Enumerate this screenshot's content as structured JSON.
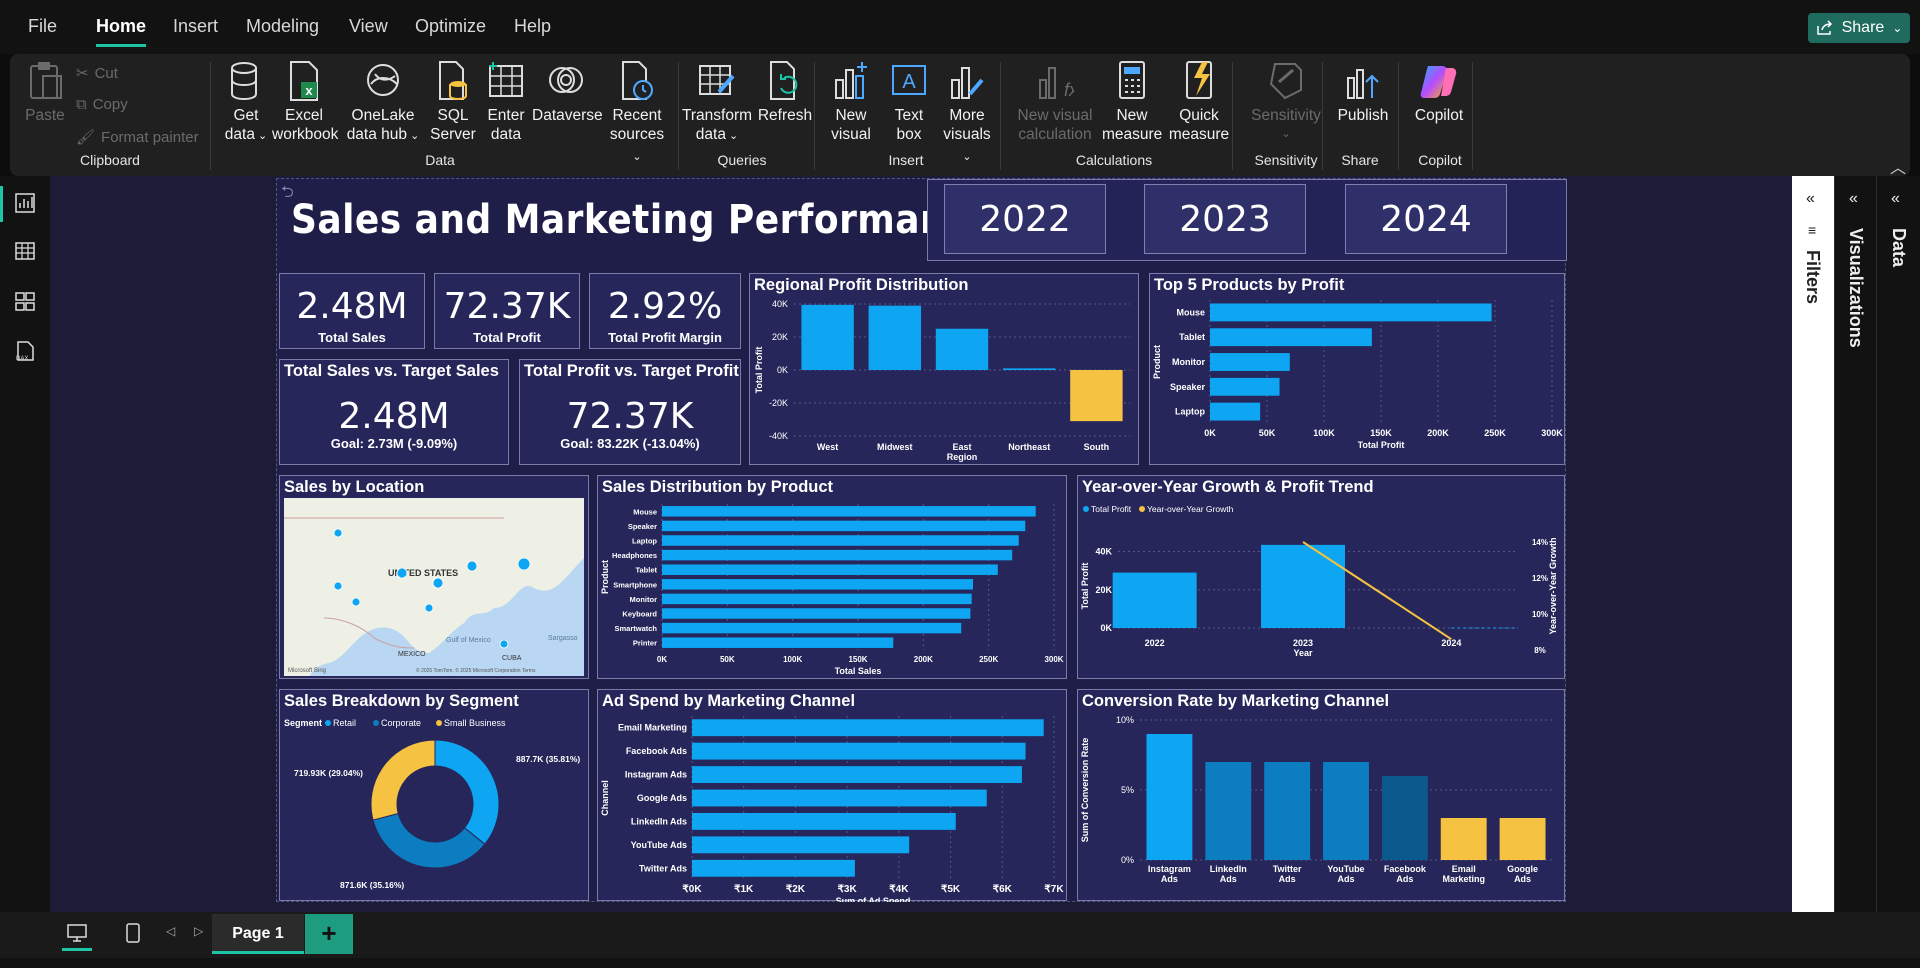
{
  "menu": {
    "items": [
      "File",
      "Home",
      "Insert",
      "Modeling",
      "View",
      "Optimize",
      "Help"
    ],
    "active": "Home",
    "share": "Share"
  },
  "ribbon": {
    "clipboard": {
      "paste": "Paste",
      "cut": "Cut",
      "copy": "Copy",
      "format_painter": "Format painter",
      "label": "Clipboard"
    },
    "data": {
      "get_data": [
        "Get",
        "data"
      ],
      "excel": [
        "Excel",
        "workbook"
      ],
      "onelake": [
        "OneLake",
        "data hub"
      ],
      "sql": [
        "SQL",
        "Server"
      ],
      "enter": [
        "Enter",
        "data"
      ],
      "dataverse": "Dataverse",
      "recent": [
        "Recent",
        "sources"
      ],
      "label": "Data"
    },
    "queries": {
      "transform": [
        "Transform",
        "data"
      ],
      "refresh": "Refresh",
      "label": "Queries"
    },
    "insert": {
      "new_visual": [
        "New",
        "visual"
      ],
      "text_box": [
        "Text",
        "box"
      ],
      "more_visuals": [
        "More",
        "visuals"
      ],
      "label": "Insert"
    },
    "calculations": {
      "new_visual_calc": [
        "New visual",
        "calculation"
      ],
      "new_measure": [
        "New",
        "measure"
      ],
      "quick_measure": [
        "Quick",
        "measure"
      ],
      "label": "Calculations"
    },
    "sensitivity": {
      "btn": "Sensitivity",
      "label": "Sensitivity"
    },
    "share": {
      "publish": "Publish",
      "label": "Share"
    },
    "copilot": {
      "btn": "Copilot",
      "label": "Copilot"
    }
  },
  "report": {
    "title": "Sales and Marketing Performance",
    "years": [
      "2022",
      "2023",
      "2024"
    ],
    "kpis": [
      {
        "value": "2.48M",
        "label": "Total Sales"
      },
      {
        "value": "72.37K",
        "label": "Total Profit"
      },
      {
        "value": "2.92%",
        "label": "Total Profit Margin"
      }
    ],
    "targets": [
      {
        "title": "Total Sales vs. Target Sales",
        "value": "2.48M",
        "goal": "Goal: 2.73M (-9.09%)"
      },
      {
        "title": "Total Profit vs. Target Profit",
        "value": "72.37K",
        "goal": "Goal: 83.22K (-13.04%)"
      }
    ],
    "map": {
      "title": "Sales by Location",
      "labels": {
        "country": "UNITED STATES",
        "mexico": "MEXICO",
        "gulf": "Gulf of Mexico",
        "cuba": "CUBA",
        "sargasso": "Sargasso",
        "brand": "Microsoft Bing",
        "copyright": "© 2025 TomTom, © 2025 Microsoft Corporation Terms"
      }
    }
  },
  "chart_data": [
    {
      "id": "regional",
      "type": "bar",
      "title": "Regional Profit Distribution",
      "categories": [
        "West",
        "Midwest",
        "East Region",
        "Northeast",
        "South"
      ],
      "values": [
        39500,
        39000,
        25000,
        1000,
        -31000
      ],
      "ylabel": "Total Profit",
      "ylim": [
        -40000,
        40000
      ],
      "yticks": [
        "40K",
        "20K",
        "0K",
        "-20K",
        "-40K"
      ],
      "colors": [
        "#0ea5f2",
        "#0ea5f2",
        "#0ea5f2",
        "#0ea5f2",
        "#f5c242"
      ]
    },
    {
      "id": "top5",
      "type": "bar",
      "orientation": "horizontal",
      "title": "Top 5 Products by Profit",
      "categories": [
        "Mouse",
        "Tablet",
        "Monitor",
        "Speaker",
        "Laptop"
      ],
      "values": [
        247000,
        142000,
        70000,
        61000,
        44000
      ],
      "xlabel": "Total Profit",
      "ylabel": "Product",
      "xlim": [
        0,
        300000
      ],
      "xticks": [
        "0K",
        "50K",
        "100K",
        "150K",
        "200K",
        "250K",
        "300K"
      ]
    },
    {
      "id": "salesprod",
      "type": "bar",
      "orientation": "horizontal",
      "title": "Sales Distribution by Product",
      "categories": [
        "Mouse",
        "Speaker",
        "Laptop",
        "Headphones",
        "Tablet",
        "Smartphone",
        "Monitor",
        "Keyboard",
        "Smartwatch",
        "Printer"
      ],
      "values": [
        286000,
        278000,
        273000,
        268000,
        257000,
        238000,
        237000,
        236000,
        229000,
        177000
      ],
      "xlabel": "Total Sales",
      "ylabel": "Product",
      "xlim": [
        0,
        300000
      ],
      "xticks": [
        "0K",
        "50K",
        "100K",
        "150K",
        "200K",
        "250K",
        "300K"
      ]
    },
    {
      "id": "yoy",
      "type": "bar",
      "title": "Year-over-Year Growth & Profit Trend",
      "categories": [
        "2022",
        "2023",
        "2024"
      ],
      "series": [
        {
          "name": "Total Profit",
          "type": "bar",
          "values": [
            29000,
            43500,
            0
          ]
        },
        {
          "name": "Year-over-Year Growth",
          "type": "line",
          "values": [
            null,
            14.0,
            8.6
          ]
        }
      ],
      "xlabel": "Year",
      "ylabel": "Total Profit",
      "y2label": "Year-over-Year Growth",
      "ylim": [
        0,
        45000
      ],
      "yticks": [
        "40K",
        "20K",
        "0K"
      ],
      "y2ticks": [
        "14%",
        "12%",
        "10%",
        "8%"
      ]
    },
    {
      "id": "segment",
      "type": "pie",
      "title": "Sales Breakdown by Segment",
      "legend_title": "Segment",
      "categories": [
        "Retail",
        "Corporate",
        "Small Business"
      ],
      "values": [
        887700,
        871600,
        719930
      ],
      "labels": [
        "887.7K (35.81%)",
        "871.6K (35.16%)",
        "719.93K (29.04%)"
      ],
      "colors": [
        "#0ea5f2",
        "#0b7dc0",
        "#f5c242"
      ]
    },
    {
      "id": "adspend",
      "type": "bar",
      "orientation": "horizontal",
      "title": "Ad Spend by Marketing Channel",
      "categories": [
        "Email Marketing",
        "Facebook Ads",
        "Instagram Ads",
        "Google Ads",
        "LinkedIn Ads",
        "YouTube Ads",
        "Twitter Ads"
      ],
      "values": [
        6800,
        6450,
        6380,
        5700,
        5100,
        4200,
        3150
      ],
      "xlabel": "Sum of Ad Spend",
      "ylabel": "Channel",
      "xlim": [
        0,
        7000
      ],
      "xticks": [
        "₹0K",
        "₹1K",
        "₹2K",
        "₹3K",
        "₹4K",
        "₹5K",
        "₹6K",
        "₹7K"
      ]
    },
    {
      "id": "conv",
      "type": "bar",
      "title": "Conversion Rate by Marketing Channel",
      "categories": [
        "Instagram Ads",
        "LinkedIn Ads",
        "Twitter Ads",
        "YouTube Ads",
        "Facebook Ads",
        "Email Marketing",
        "Google Ads"
      ],
      "values": [
        9.0,
        7.0,
        7.0,
        7.0,
        6.0,
        3.0,
        3.0
      ],
      "ylabel": "Sum of Conversion Rate",
      "ylim": [
        0,
        10
      ],
      "yticks": [
        "10%",
        "5%",
        "0%"
      ],
      "colors": [
        "#0ea5f2",
        "#0b7dc0",
        "#0b7dc0",
        "#0b7dc0",
        "#0a5a8e",
        "#f5c242",
        "#f5c242"
      ]
    }
  ],
  "panes": {
    "filters": "Filters",
    "visualizations": "Visualizations",
    "data": "Data"
  },
  "pagebar": {
    "page": "Page 1",
    "add": "+"
  },
  "colors": {
    "accent": "#1bc5a6",
    "bar": "#0ea5f2",
    "yellow": "#f5c242",
    "card": "#26265a"
  }
}
